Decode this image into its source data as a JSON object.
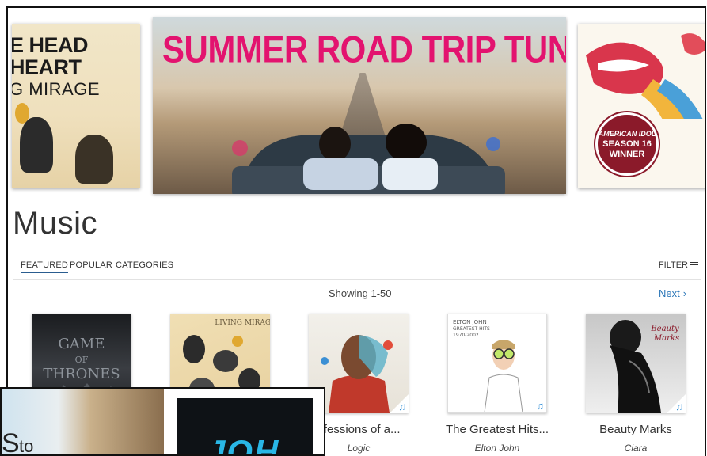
{
  "carousel": {
    "left_banner": {
      "lines": [
        "E HEAD",
        "HEART",
        "G MIRAGE"
      ]
    },
    "center_banner": {
      "title": "SUMMER ROAD TRIP TUNES"
    },
    "right_banner": {
      "badge_line1": "AMERICAN IDOL",
      "badge_line2": "SEASON 16",
      "badge_line3": "WINNER"
    }
  },
  "page": {
    "title": "Music"
  },
  "tabs": [
    {
      "label": "FEATURED",
      "active": true
    },
    {
      "label": "POPULAR",
      "active": false
    },
    {
      "label": "CATEGORIES",
      "active": false
    }
  ],
  "filter": {
    "label": "FILTER",
    "icon": "menu-icon"
  },
  "pagination": {
    "showing": "Showing 1-50",
    "next_label": "Next"
  },
  "albums": [
    {
      "title": "",
      "artist": "",
      "art_text": "GAME OF THRONES",
      "colors": [
        "#1a1c1f",
        "#3a3d42"
      ]
    },
    {
      "title": "",
      "artist": "",
      "art_text": "LIVING MIRAGE",
      "colors": [
        "#f0dfb4",
        "#e8d19f"
      ]
    },
    {
      "title": "nfessions of a...",
      "artist": "Logic",
      "colors": [
        "#f2f0ea",
        "#c0392b"
      ]
    },
    {
      "title": "The Greatest Hits...",
      "artist": "Elton John",
      "art_text": "ELTON JOHN GREATEST HITS 1970-2002",
      "colors": [
        "#ffffff"
      ]
    },
    {
      "title": "Beauty Marks",
      "artist": "Ciara",
      "art_text": "Beauty Marks",
      "colors": [
        "#c7c7c7",
        "#111111"
      ]
    }
  ],
  "overlay": {
    "left_text_big": "S",
    "left_text_small": "to",
    "right_text": "JOH"
  },
  "accent": {
    "link": "#2a76b8",
    "tab_underline": "#2a5d8f",
    "banner_title": "#e3136f",
    "badge": "#8b1a2a",
    "music_note": "#2a8bd6"
  }
}
